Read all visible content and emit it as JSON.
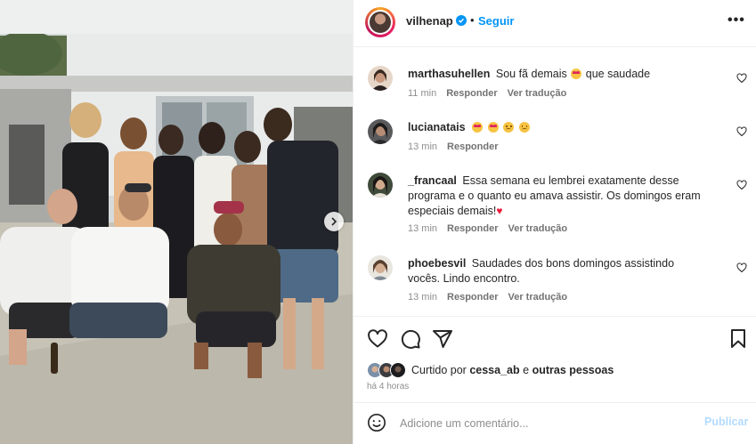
{
  "post": {
    "username": "vilhenap",
    "follow_label": "Seguir",
    "separator": "•",
    "more_icon": "more-horizontal-icon"
  },
  "comments": [
    {
      "username": "marthasuhellen",
      "text_before": "Sou fã demais",
      "text_after": "que saudade",
      "time": "11 min",
      "reply": "Responder",
      "translate": "Ver tradução"
    },
    {
      "username": "lucianatais",
      "time": "13 min",
      "reply": "Responder"
    },
    {
      "username": "_francaal",
      "text": "Essa semana eu lembrei exatamente desse programa e o quanto eu amava assistir. Os domingos eram especiais demais!",
      "time": "13 min",
      "reply": "Responder",
      "translate": "Ver tradução"
    },
    {
      "username": "phoebesvil",
      "text": "Saudades dos bons domingos assistindo vocês. Lindo encontro.",
      "time": "13 min",
      "reply": "Responder",
      "translate": "Ver tradução"
    }
  ],
  "likes": {
    "prefix": "Curtido por",
    "user": "cessa_ab",
    "connector": "e",
    "others": "outras pessoas"
  },
  "timestamp": "há 4 horas",
  "composer": {
    "placeholder": "Adicione um comentário...",
    "post_label": "Publicar"
  },
  "colors": {
    "accent": "#0095f6",
    "post_disabled": "#b3dbff",
    "heart_red": "#ed1c3c"
  }
}
